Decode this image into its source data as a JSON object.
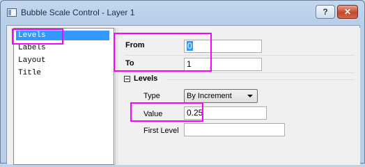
{
  "window": {
    "title": "Bubble Scale Control - Layer 1",
    "help_label": "?",
    "close_label": "✕"
  },
  "tree": {
    "items": [
      {
        "label": "Levels",
        "selected": true
      },
      {
        "label": "Labels",
        "selected": false
      },
      {
        "label": "Layout",
        "selected": false
      },
      {
        "label": "Title",
        "selected": false
      }
    ]
  },
  "form": {
    "from_label": "From",
    "from_value": "0",
    "to_label": "To",
    "to_value": "1",
    "levels_section_label": "Levels",
    "type_label": "Type",
    "type_value": "By Increment",
    "value_label": "Value",
    "value_value": "0.25",
    "first_level_label": "First Level",
    "first_level_value": ""
  },
  "colors": {
    "highlight": "#ff00ff",
    "selection": "#3399ff"
  }
}
